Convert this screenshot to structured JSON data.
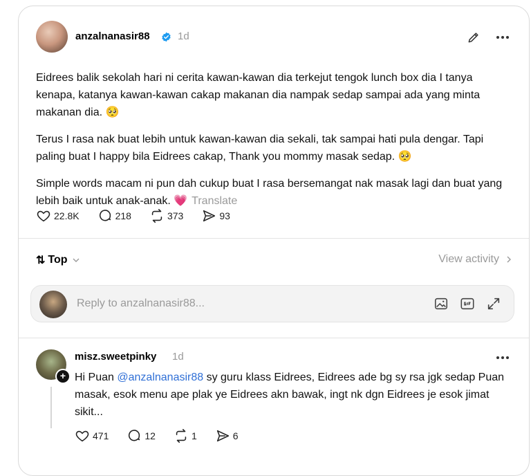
{
  "post": {
    "username": "anzalnanasir88",
    "time": "1d",
    "paragraphs": [
      "Eidrees balik sekolah hari ni cerita kawan-kawan dia terkejut tengok lunch box dia I tanya kenapa, katanya kawan-kawan cakap makanan dia nampak sedap sampai ada yang minta makanan dia. 🥺",
      "Terus I rasa nak buat lebih untuk kawan-kawan dia sekali, tak sampai hati pula dengar. Tapi paling buat I happy bila Eidrees cakap, Thank you mommy masak sedap. 🥺"
    ],
    "last_paragraph": "Simple words macam ni pun dah cukup buat I rasa bersemangat nak masak lagi dan buat yang lebih baik untuk anak-anak. 💗",
    "translate_label": "Translate",
    "stats": {
      "likes": "22.8K",
      "comments": "218",
      "reposts": "373",
      "shares": "93"
    }
  },
  "sort": {
    "label": "Top",
    "view_activity": "View activity"
  },
  "reply": {
    "placeholder": "Reply to anzalnanasir88..."
  },
  "comment": {
    "username": "misz.sweetpinky",
    "time": "1d",
    "text_before": "Hi Puan ",
    "mention": "@anzalnanasir88",
    "text_after": " sy guru klass Eidrees, Eidrees ade bg sy rsa jgk sedap Puan masak, esok menu ape plak ye Eidrees akn bawak, ingt nk dgn Eidrees je esok jimat sikit...",
    "stats": {
      "likes": "471",
      "comments": "12",
      "reposts": "1",
      "shares": "6"
    }
  },
  "colors": {
    "accent": "#2f6fd6",
    "muted": "#9a9a9a",
    "verified": "#1d9bf0"
  }
}
